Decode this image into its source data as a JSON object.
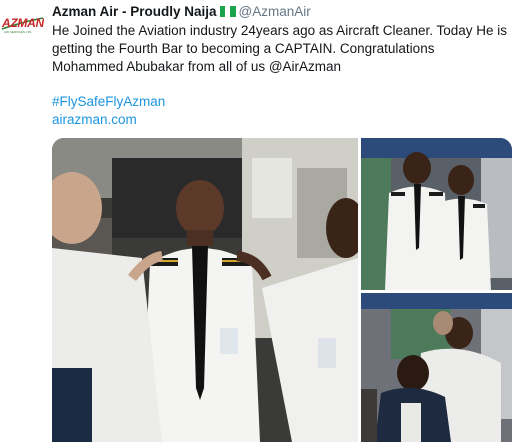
{
  "tweet": {
    "avatar": {
      "logo_text": "AZMAN",
      "logo_subtext": "AIR SERVICES LTD"
    },
    "author": {
      "display_name": "Azman Air - Proudly Naija",
      "handle": "@AzmanAir"
    },
    "body_text": "He Joined the Aviation industry 24years ago as Aircraft Cleaner. Today He is getting the Fourth Bar to becoming a CAPTAIN. Congratulations Mohammed Abubakar from all of us @AirAzman",
    "hashtag": "#FlySafeFlyAzman",
    "link": "airazman.com",
    "media": [
      {
        "description_icon": "photo-main"
      },
      {
        "description_icon": "photo-top-right"
      },
      {
        "description_icon": "photo-bottom-right"
      }
    ]
  },
  "colors": {
    "link_blue": "#1b95e0",
    "handle_gray": "#657786",
    "text": "#14171a",
    "brand_red": "#c62828",
    "flag_green": "#1aa34a"
  }
}
